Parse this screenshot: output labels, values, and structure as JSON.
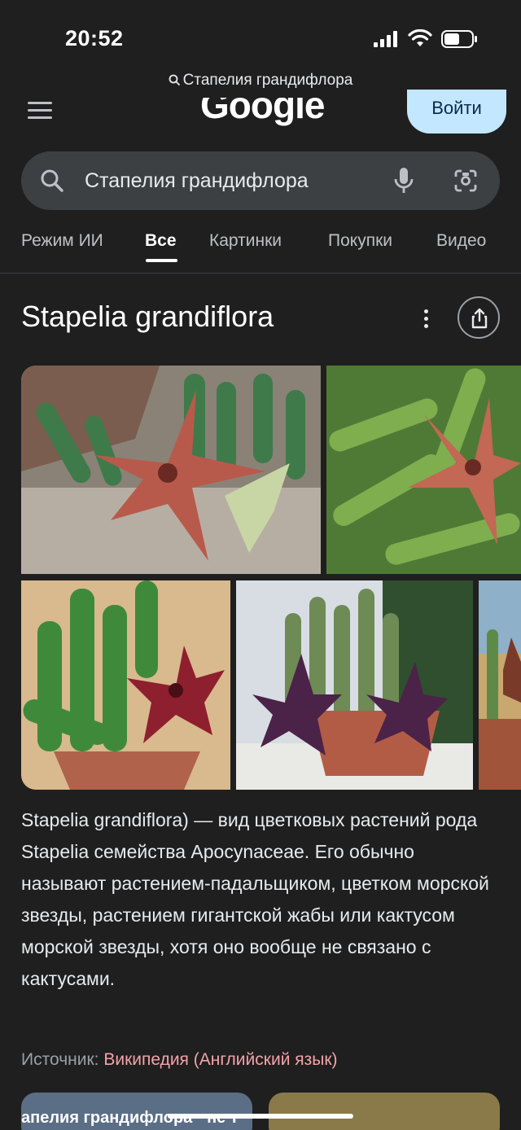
{
  "status_bar": {
    "time": "20:52"
  },
  "browser": {
    "url_text": "Стапелия грандифлора"
  },
  "header": {
    "logo_text": "Google",
    "signin_label": "Войти"
  },
  "search": {
    "query": "Стапелия грандифлора"
  },
  "tabs": [
    {
      "label": "Режим ИИ",
      "active": false
    },
    {
      "label": "Все",
      "active": true
    },
    {
      "label": "Картинки",
      "active": false
    },
    {
      "label": "Покупки",
      "active": false
    },
    {
      "label": "Видео",
      "active": false
    }
  ],
  "knowledge_panel": {
    "title": "Stapelia grandiflora",
    "description": "Stapelia grandiflora) — вид цветковых растений рода Stapelia семейства Apocynaceae. Его обычно называют растением-падальщиком, цветком морской звезды, растением гигантской жабы или кактусом морской звезды, хотя оно вообще не связано с кактусами.",
    "source_label": "Источник:",
    "source_link": "Википедия (Английский язык)"
  },
  "bottom_cards": [
    {
      "text": "апелия грандифлора · не т"
    }
  ],
  "colors": {
    "background": "#1f1f1f",
    "search_bg": "#3c4043",
    "signin_bg": "#c2e7ff",
    "source_link": "#f4a3a8"
  }
}
